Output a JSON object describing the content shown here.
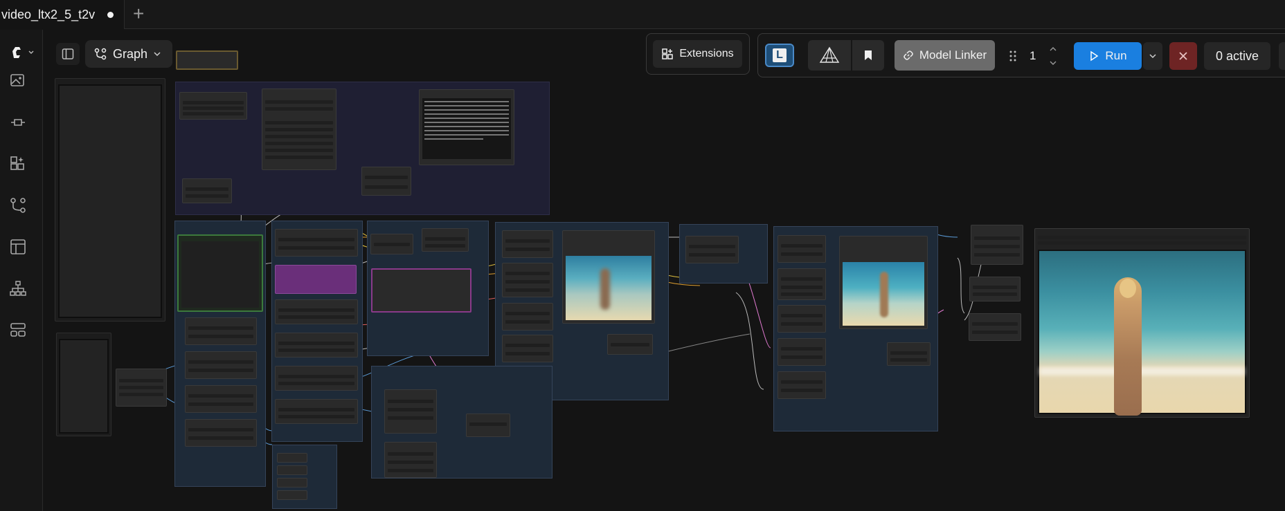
{
  "tab": {
    "title": "video_ltx2_5_t2v",
    "unsaved": true
  },
  "graph_toggle": {
    "label": "Graph"
  },
  "toolbar": {
    "extensions_label": "Extensions",
    "model_linker_label": "Model Linker",
    "batch_count": "1",
    "run_label": "Run",
    "active_label": "0 active",
    "l_badge": "L"
  },
  "colors": {
    "accent": "#1a7fe0",
    "stop": "#6e2424",
    "group_blue": "#263545",
    "group_purple": "#25253a",
    "node_purple": "#6a2f7a",
    "node_green": "#3c7a3c"
  },
  "icons": {
    "sidebar": [
      "images-icon",
      "nodes-icon",
      "models-icon",
      "workflows-icon",
      "templates-icon",
      "hierarchy-icon",
      "layout-icon"
    ],
    "toolbar": [
      "extensions-icon",
      "pyramid-icon",
      "bookmark-icon",
      "link-icon",
      "drag-handle-icon",
      "play-icon",
      "chevron-down-icon",
      "close-icon"
    ]
  }
}
